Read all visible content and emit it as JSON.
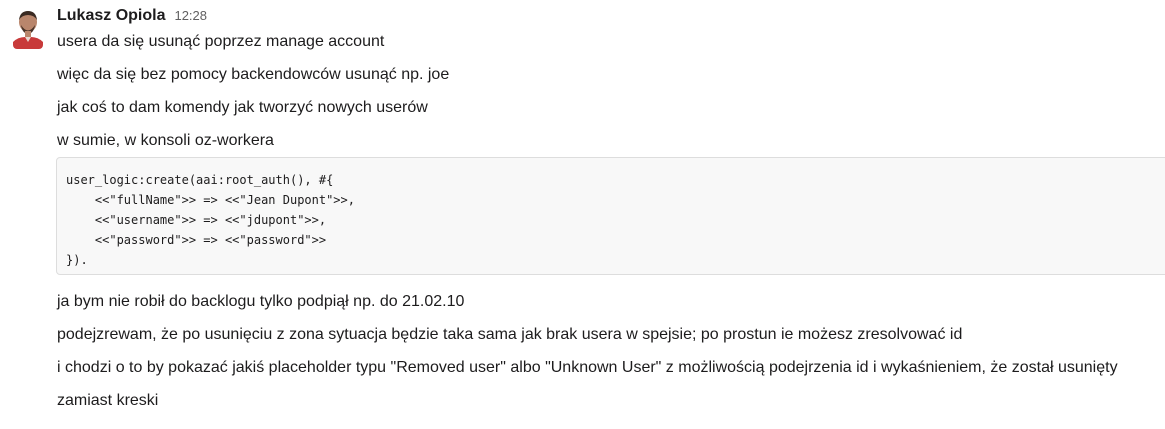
{
  "message": {
    "author": "Lukasz Opiola",
    "time": "12:28",
    "lines_before_code": [
      "usera da się usunąć poprzez manage account",
      "więc da się bez pomocy backendowców usunąć np. joe",
      "jak coś to dam komendy jak tworzyć nowych userów",
      "w sumie, w konsoli oz-workera"
    ],
    "code_lines": [
      "user_logic:create(aai:root_auth(), #{",
      "    <<\"fullName\">> => <<\"Jean Dupont\">>,",
      "    <<\"username\">> => <<\"jdupont\">>,",
      "    <<\"password\">> => <<\"password\">>",
      "})."
    ],
    "lines_after_code": [
      "ja bym nie robił do backlogu tylko podpiął np. do 21.02.10",
      "podejzrewam, że po usunięciu z zona sytuacja będzie taka sama jak brak usera w spejsie; po prostun ie możesz zresolvować id",
      "i chodzi o to by pokazać jakiś placeholder typu \"Removed user\" albo \"Unknown User\" z możliwością podejrzenia id i wykaśnieniem, że został usunięty",
      "zamiast kreski"
    ]
  }
}
